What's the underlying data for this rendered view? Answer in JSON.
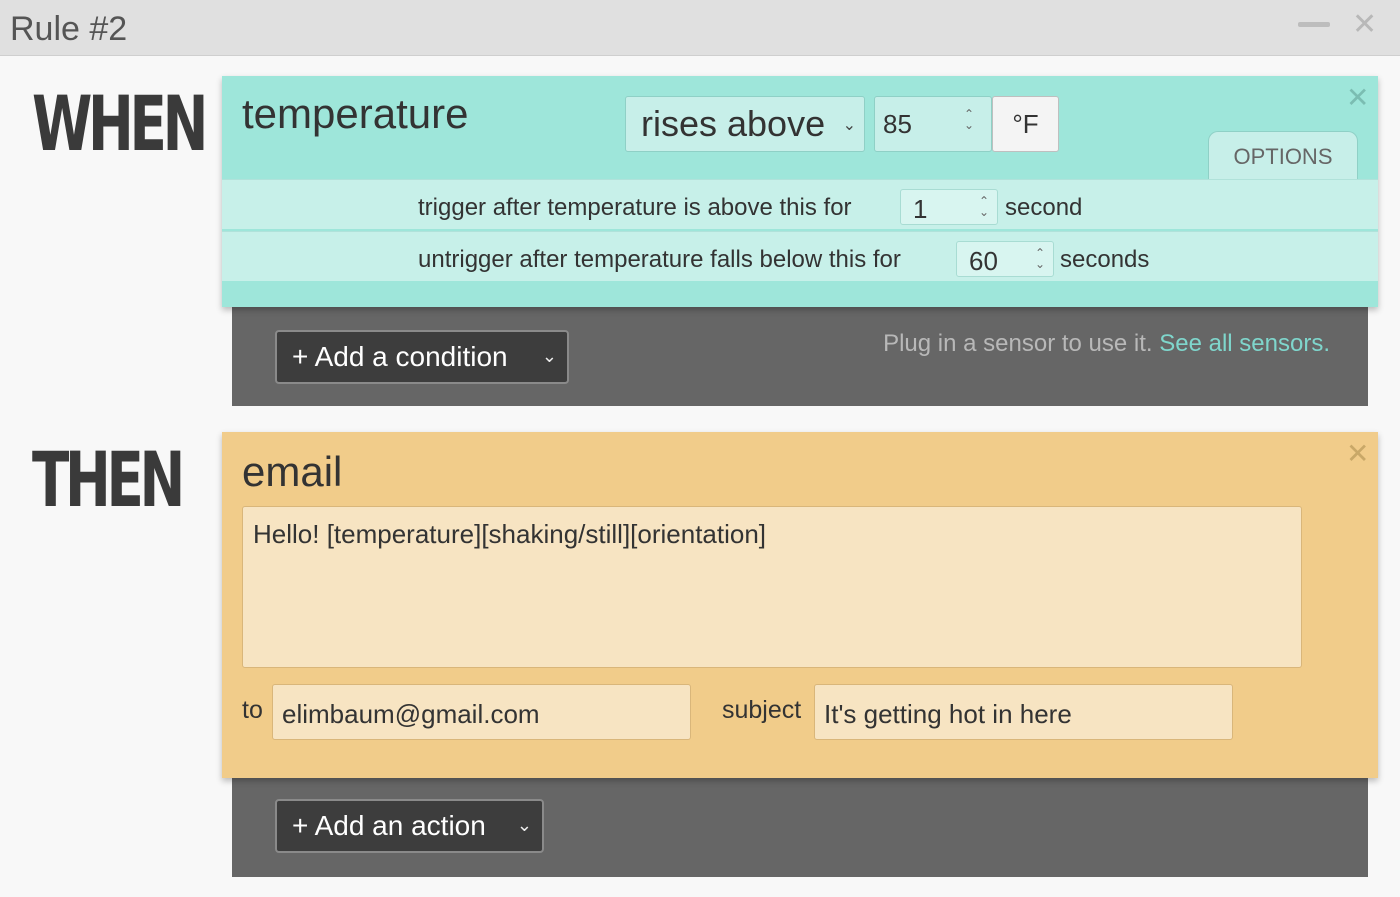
{
  "window": {
    "title": "Rule #2"
  },
  "when": {
    "label": "WHEN",
    "condition": {
      "name": "temperature",
      "operator": "rises above",
      "threshold": "85",
      "unit": "°F",
      "options_tab": "OPTIONS",
      "trigger": {
        "prefix": "trigger after temperature is above this for",
        "value": "1",
        "suffix": "second"
      },
      "untrigger": {
        "prefix": "untrigger after temperature falls below this for",
        "value": "60",
        "suffix": "seconds"
      }
    },
    "add_condition_label": "+ Add a condition",
    "hint_text": "Plug in a sensor to use it.",
    "hint_link": "See all sensors."
  },
  "then": {
    "label": "THEN",
    "action": {
      "name": "email",
      "body": "Hello! [temperature][shaking/still][orientation]",
      "to_label": "to",
      "to_value": "elimbaum@gmail.com",
      "subject_label": "subject",
      "subject_value": "It's getting hot in here"
    },
    "add_action_label": "+ Add an action"
  },
  "colors": {
    "condition_card": "#9ee6da",
    "action_card": "#f1cc8a",
    "tray": "#666666",
    "link": "#7fd6cc"
  },
  "icons": {
    "minimize": "minimize-icon",
    "window_close": "close-icon",
    "card_close": "close-icon",
    "chevron": "chevron-down-icon",
    "spinner": "spinner-arrows-icon"
  }
}
